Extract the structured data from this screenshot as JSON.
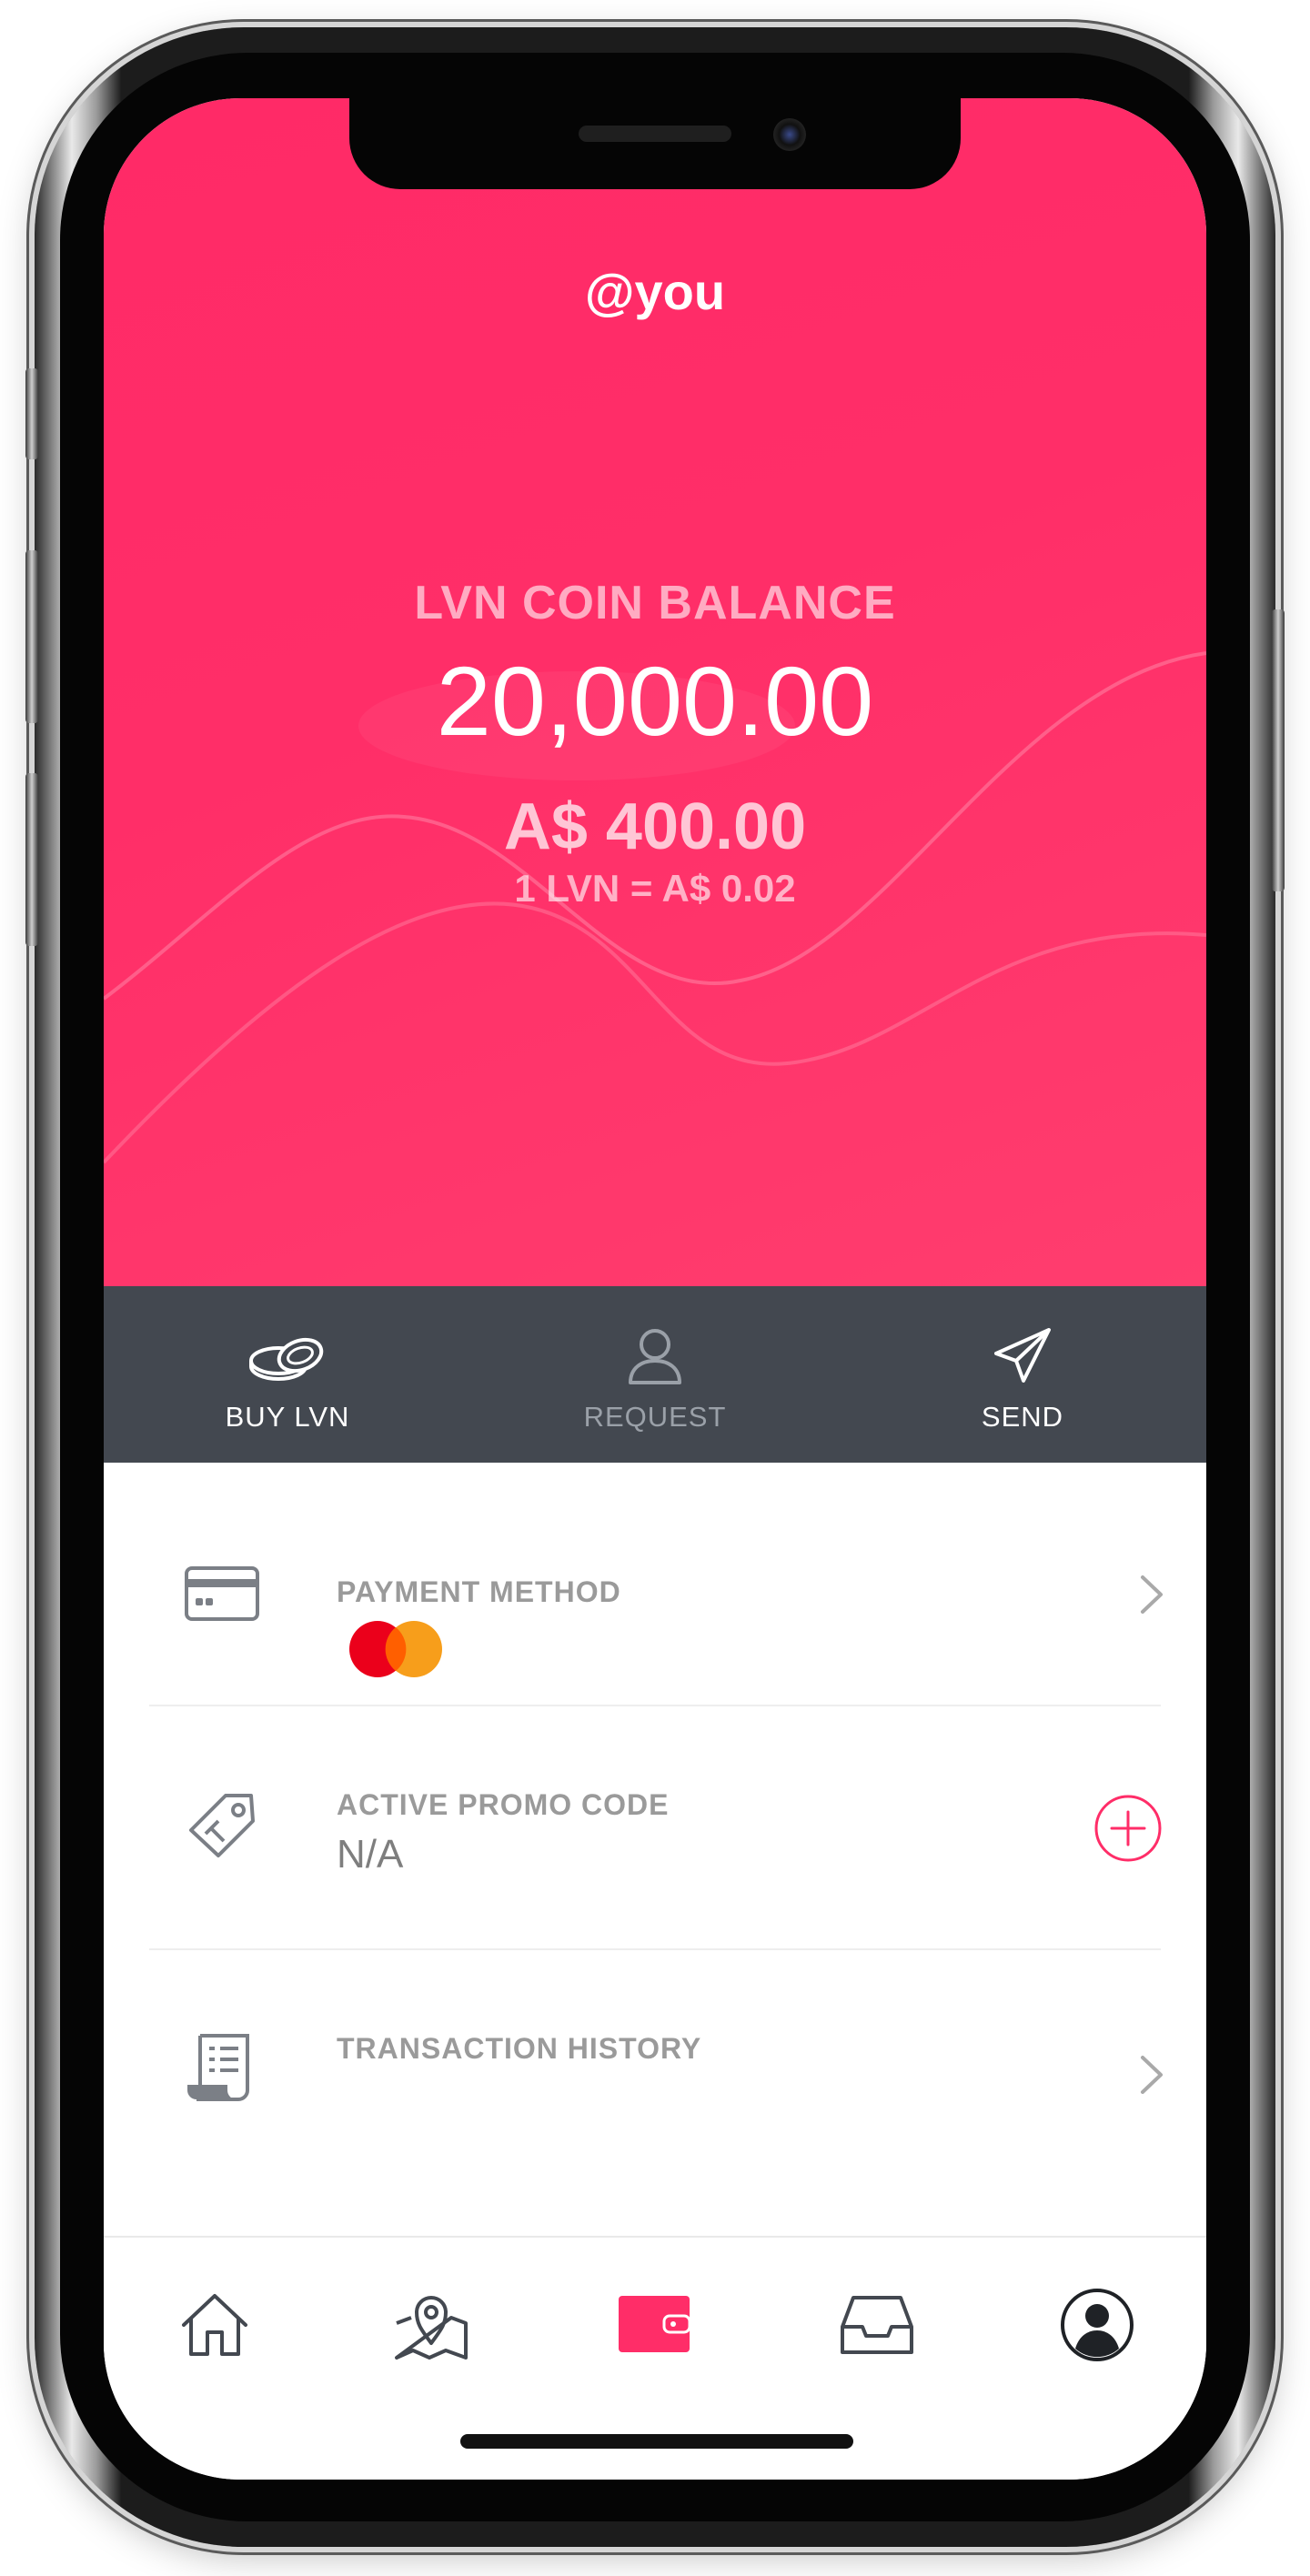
{
  "header": {
    "username": "@you",
    "balance_label": "LVN COIN BALANCE",
    "balance_value": "20,000.00",
    "fiat_value": "A$ 400.00",
    "exchange_rate": "1 LVN = A$ 0.02"
  },
  "actions": [
    {
      "label": "BUY LVN",
      "icon": "coins-icon",
      "active": true
    },
    {
      "label": "REQUEST",
      "icon": "person-icon",
      "active": false
    },
    {
      "label": "SEND",
      "icon": "paper-plane-icon",
      "active": true
    }
  ],
  "rows": {
    "payment": {
      "title": "PAYMENT METHOD",
      "icon": "credit-card-icon",
      "card_brand_icon": "mastercard-icon"
    },
    "promo": {
      "title": "ACTIVE PROMO CODE",
      "value": "N/A",
      "icon": "tag-icon"
    },
    "history": {
      "title": "TRANSACTION HISTORY",
      "icon": "receipt-icon"
    }
  },
  "tabbar": [
    {
      "name": "home-icon",
      "active": false
    },
    {
      "name": "map-pin-icon",
      "active": false
    },
    {
      "name": "wallet-icon",
      "active": true
    },
    {
      "name": "inbox-tray-icon",
      "active": false
    },
    {
      "name": "profile-icon",
      "active": false
    }
  ],
  "colors": {
    "accent": "#FF2D68",
    "action_bar": "#434850",
    "muted_text": "#9A9A9A",
    "mastercard_red": "#EB001B",
    "mastercard_orange": "#F79E1B"
  }
}
